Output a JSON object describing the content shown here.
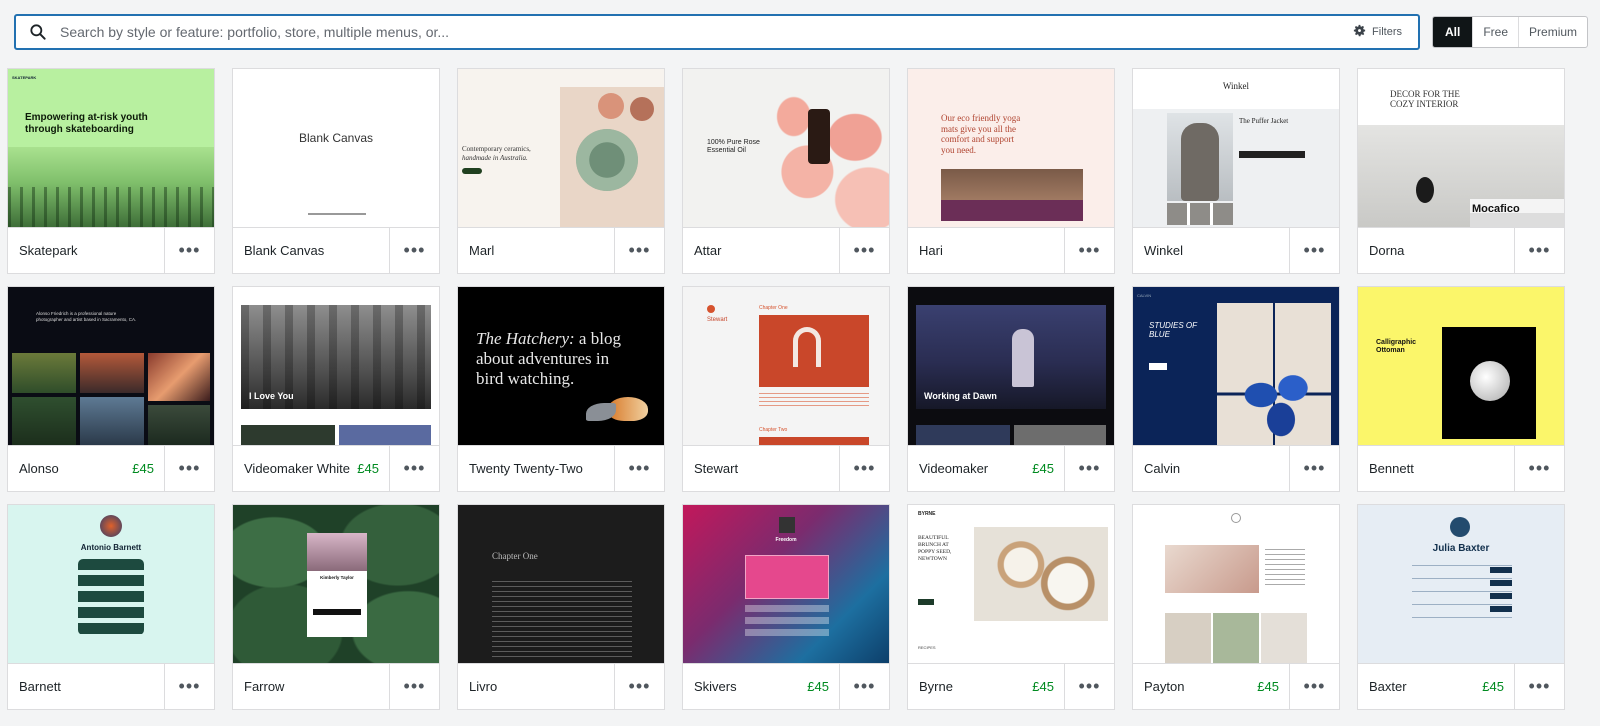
{
  "search": {
    "placeholder": "Search by style or feature: portfolio, store, multiple menus, or...",
    "icon": "search-icon",
    "filters_label": "Filters",
    "filters_icon": "gear-icon"
  },
  "filter_tabs": [
    {
      "label": "All",
      "active": true
    },
    {
      "label": "Free",
      "active": false
    },
    {
      "label": "Premium",
      "active": false
    }
  ],
  "more_label": "•••",
  "themes": [
    {
      "name": "Skatepark",
      "price": "",
      "thumb": {
        "headline": "Empowering at-risk youth through skateboarding",
        "site": "SKATEPARK",
        "color": "#b8f0a0"
      }
    },
    {
      "name": "Blank Canvas",
      "price": "",
      "thumb": {
        "headline": "Blank Canvas",
        "color": "#ffffff"
      }
    },
    {
      "name": "Marl",
      "price": "",
      "thumb": {
        "headline_line1": "Contemporary ceramics,",
        "headline_line2": "handmade in Australia.",
        "color": "#f7f3ee"
      }
    },
    {
      "name": "Attar",
      "price": "",
      "thumb": {
        "headline_line1": "100% Pure Rose",
        "headline_line2": "Essential Oil",
        "color": "#f2f2f0"
      }
    },
    {
      "name": "Hari",
      "price": "",
      "thumb": {
        "headline_line1": "Our eco friendly yoga",
        "headline_line2": "mats give you all the",
        "headline_line3": "comfort and support",
        "headline_line4": "you need.",
        "color": "#fbeeea"
      }
    },
    {
      "name": "Winkel",
      "price": "",
      "thumb": {
        "site": "Winkel",
        "product": "The Puffer Jacket",
        "color": "#ffffff"
      }
    },
    {
      "name": "Dorna",
      "price": "",
      "thumb": {
        "headline_line1": "DECOR FOR THE",
        "headline_line2": "COZY INTERIOR",
        "caption": "Mocafico",
        "color": "#ffffff"
      }
    },
    {
      "name": "Alonso",
      "price": "£45",
      "thumb": {
        "headline": "Alonso Friedrich is a professional nature photographer and artist based in Sacramento, CA.",
        "color": "#0a0c14"
      }
    },
    {
      "name": "Videomaker White",
      "price": "£45",
      "thumb": {
        "headline": "I Love You",
        "color": "#ffffff"
      }
    },
    {
      "name": "Twenty Twenty-Two",
      "price": "",
      "thumb": {
        "headline_em": "The Hatchery:",
        "headline_line1": "a blog",
        "headline_line2": "about adventures in",
        "headline_line3": "bird watching.",
        "color": "#000000"
      }
    },
    {
      "name": "Stewart",
      "price": "",
      "thumb": {
        "site": "Stewart",
        "heading1": "Chapter One",
        "heading2": "Chapter Two",
        "color": "#f4f4f4"
      }
    },
    {
      "name": "Videomaker",
      "price": "£45",
      "thumb": {
        "headline": "Working at Dawn",
        "color": "#0c0c10"
      }
    },
    {
      "name": "Calvin",
      "price": "",
      "thumb": {
        "site": "CALVIN",
        "headline_line1": "STUDIES OF",
        "headline_line2": "BLUE",
        "color": "#0b2458"
      }
    },
    {
      "name": "Bennett",
      "price": "",
      "thumb": {
        "headline_line1": "Calligraphic",
        "headline_line2": "Ottoman",
        "color": "#fbf66a"
      }
    },
    {
      "name": "Barnett",
      "price": "",
      "thumb": {
        "headline": "Antonio Barnett",
        "color": "#d8f5ef"
      }
    },
    {
      "name": "Farrow",
      "price": "",
      "thumb": {
        "headline": "Kimberly Taylor",
        "color": "#1f4128"
      }
    },
    {
      "name": "Livro",
      "price": "",
      "thumb": {
        "headline": "Chapter One",
        "color": "#1c1c1c"
      }
    },
    {
      "name": "Skivers",
      "price": "£45",
      "thumb": {
        "headline": "Freedom",
        "color": "#c2185b"
      }
    },
    {
      "name": "Byrne",
      "price": "£45",
      "thumb": {
        "site": "BYRNE",
        "headline_line1": "BEAUTIFUL",
        "headline_line2": "BRUNCH AT",
        "headline_line3": "POPPY SEED,",
        "headline_line4": "NEWTOWN",
        "section": "RECIPES",
        "color": "#ffffff"
      }
    },
    {
      "name": "Payton",
      "price": "£45",
      "thumb": {
        "color": "#ffffff"
      }
    },
    {
      "name": "Baxter",
      "price": "£45",
      "thumb": {
        "headline": "Julia Baxter",
        "color": "#e6edf4"
      }
    }
  ]
}
